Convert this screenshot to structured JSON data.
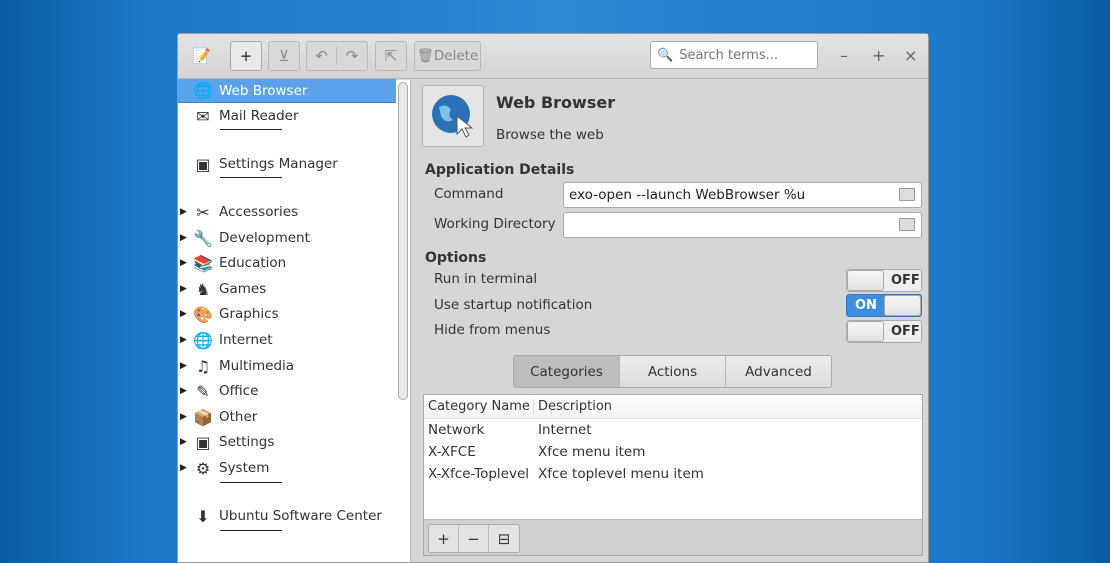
{
  "toolbar": {
    "delete_label": "Delete",
    "search_placeholder": "Search terms..."
  },
  "sidebar": {
    "items": [
      {
        "label": "Web Browser",
        "icon": "globe-icon",
        "selected": true
      },
      {
        "label": "Mail Reader",
        "icon": "mail-icon"
      },
      {
        "label": "Settings Manager",
        "icon": "settings-icon"
      },
      {
        "label": "Accessories",
        "icon": "accessories-icon",
        "expandable": true
      },
      {
        "label": "Development",
        "icon": "development-icon",
        "expandable": true
      },
      {
        "label": "Education",
        "icon": "education-icon",
        "expandable": true
      },
      {
        "label": "Games",
        "icon": "games-icon",
        "expandable": true
      },
      {
        "label": "Graphics",
        "icon": "graphics-icon",
        "expandable": true
      },
      {
        "label": "Internet",
        "icon": "internet-icon",
        "expandable": true
      },
      {
        "label": "Multimedia",
        "icon": "multimedia-icon",
        "expandable": true
      },
      {
        "label": "Office",
        "icon": "office-icon",
        "expandable": true
      },
      {
        "label": "Other",
        "icon": "other-icon",
        "expandable": true
      },
      {
        "label": "Settings",
        "icon": "settings-icon",
        "expandable": true
      },
      {
        "label": "System",
        "icon": "system-icon",
        "expandable": true
      },
      {
        "label": "Ubuntu Software Center",
        "icon": "software-center-icon"
      }
    ]
  },
  "detail": {
    "title": "Web Browser",
    "subtitle": "Browse the web",
    "app_details_heading": "Application Details",
    "command_label": "Command",
    "command_value": "exo-open --launch WebBrowser %u",
    "workdir_label": "Working Directory",
    "workdir_value": "",
    "options_heading": "Options",
    "options": [
      {
        "label": "Run in terminal",
        "state": "OFF"
      },
      {
        "label": "Use startup notification",
        "state": "ON"
      },
      {
        "label": "Hide from menus",
        "state": "OFF"
      }
    ],
    "tabs": [
      "Categories",
      "Actions",
      "Advanced"
    ],
    "table": {
      "headers": [
        "Category Name",
        "Description"
      ],
      "rows": [
        [
          "Network",
          "Internet"
        ],
        [
          "X-XFCE",
          "Xfce menu item"
        ],
        [
          "X-Xfce-Toplevel",
          "Xfce toplevel menu item"
        ]
      ]
    }
  }
}
